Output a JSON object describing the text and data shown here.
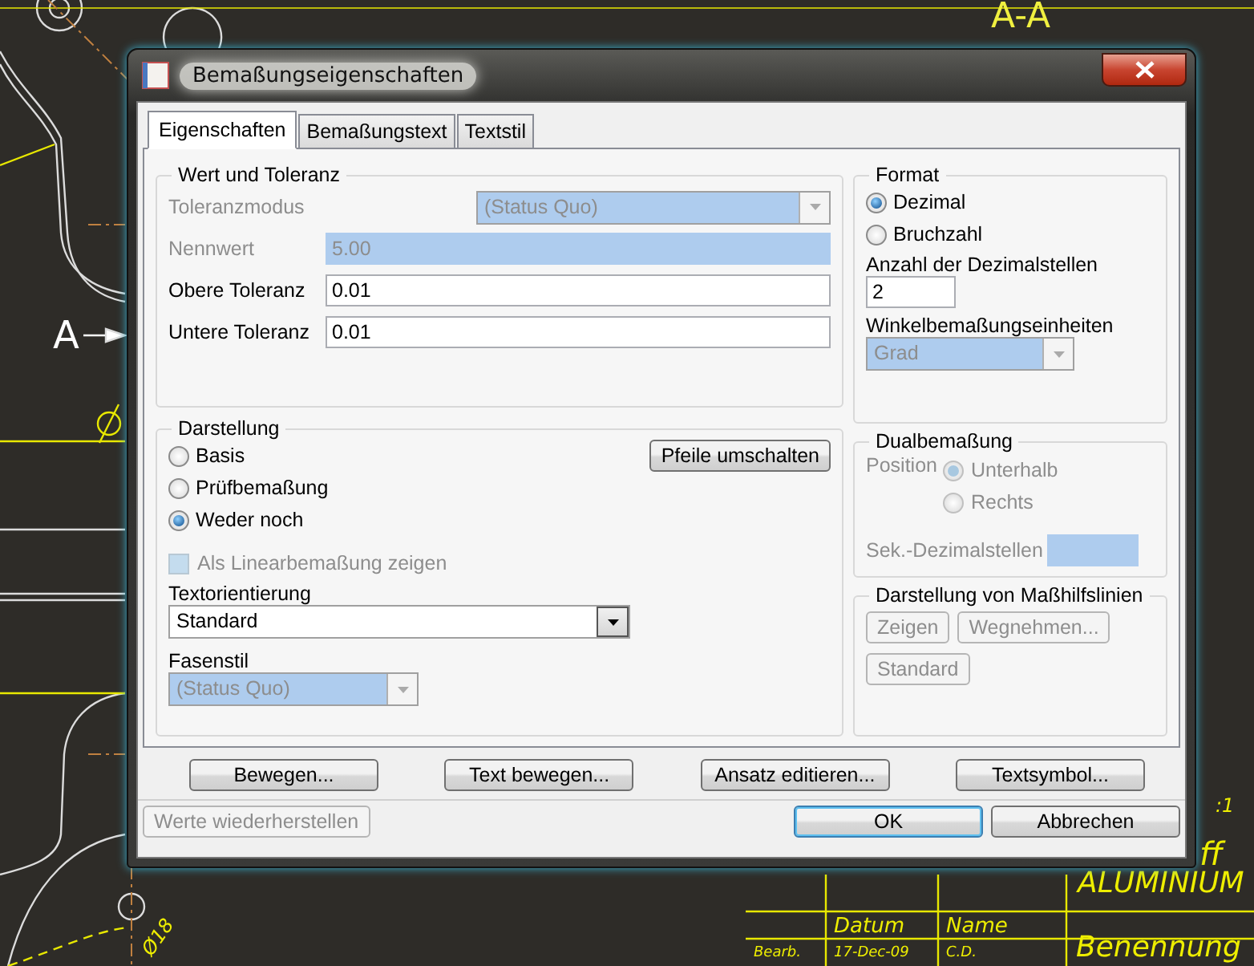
{
  "drawing": {
    "section_top": "A-A",
    "section_left": "A",
    "diameter": "Ø18",
    "scale_fragment": ":1",
    "material_fragment": "ff",
    "material": "ALUMINIUM",
    "headers": [
      "Datum",
      "Name"
    ],
    "row": [
      "Bearb.",
      "17-Dec-09",
      "C.D."
    ],
    "title": "Benennung"
  },
  "window": {
    "title": "Bemaßungseigenschaften"
  },
  "tabs": [
    {
      "label": "Eigenschaften",
      "selected": true
    },
    {
      "label": "Bemaßungstext",
      "selected": false
    },
    {
      "label": "Textstil",
      "selected": false
    }
  ],
  "value_tolerance": {
    "title": "Wert und Toleranz",
    "fields": [
      {
        "label": "Toleranzmodus",
        "kind": "select",
        "value": "(Status Quo)",
        "disabled": true
      },
      {
        "label": "Nennwert",
        "kind": "input",
        "value": "5.00",
        "disabled": true
      },
      {
        "label": "Obere Toleranz",
        "kind": "input",
        "value": "0.01",
        "disabled": false
      },
      {
        "label": "Untere Toleranz",
        "kind": "input",
        "value": "0.01",
        "disabled": false
      }
    ]
  },
  "display": {
    "title": "Darstellung",
    "radios": [
      {
        "label": "Basis",
        "selected": false
      },
      {
        "label": "Prüfbemaßung",
        "selected": false
      },
      {
        "label": "Weder noch",
        "selected": true
      }
    ],
    "toggle_button": "Pfeile umschalten",
    "checkbox": {
      "label": "Als Linearbemaßung zeigen",
      "checked": false,
      "disabled": true
    },
    "orientation": {
      "label": "Textorientierung",
      "value": "Standard",
      "disabled": false
    },
    "chamfer": {
      "label": "Fasenstil",
      "value": "(Status Quo)",
      "disabled": true
    }
  },
  "format": {
    "title": "Format",
    "radios": [
      {
        "label": "Dezimal",
        "selected": true
      },
      {
        "label": "Bruchzahl",
        "selected": false
      }
    ],
    "decimals_label": "Anzahl der Dezimalstellen",
    "decimals_value": "2",
    "angle_label": "Winkelbemaßungseinheiten",
    "angle_value": "Grad",
    "angle_disabled": true
  },
  "dual": {
    "title": "Dualbemaßung",
    "disabled": true,
    "position_label": "Position",
    "radios": [
      {
        "label": "Unterhalb",
        "selected": true
      },
      {
        "label": "Rechts",
        "selected": false
      }
    ],
    "secondary_label": "Sek.-Dezimalstellen"
  },
  "extension_lines": {
    "title": "Darstellung von Maßhilfslinien",
    "buttons": [
      {
        "label": "Zeigen",
        "disabled": true
      },
      {
        "label": "Wegnehmen...",
        "disabled": true
      },
      {
        "label": "Standard",
        "disabled": true
      }
    ]
  },
  "actions": [
    "Bewegen...",
    "Text bewegen...",
    "Ansatz editieren...",
    "Textsymbol..."
  ],
  "footer": {
    "restore": {
      "label": "Werte wiederherstellen",
      "disabled": true
    },
    "ok": "OK",
    "cancel": "Abbrechen"
  }
}
